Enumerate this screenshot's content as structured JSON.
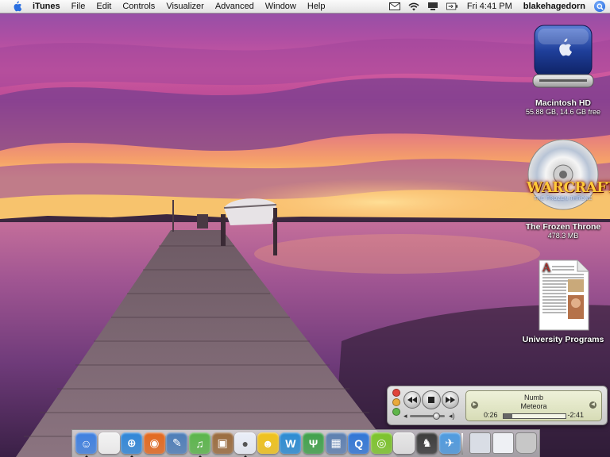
{
  "menubar": {
    "app_name": "iTunes",
    "menus": [
      "File",
      "Edit",
      "Controls",
      "Visualizer",
      "Advanced",
      "Window",
      "Help"
    ],
    "clock": "Fri 4:41 PM",
    "username": "blakehagedorn",
    "extras_icons": [
      "mail-icon",
      "wifi-icon",
      "display-icon",
      "battery-icon"
    ]
  },
  "desktop": {
    "icons": [
      {
        "label": "Macintosh HD",
        "sub": "55.88 GB, 14.6 GB free",
        "icon": "hard-drive-icon"
      },
      {
        "label": "The Frozen Throne",
        "sub": "478.3 MB",
        "icon": "cd-disc-icon",
        "art_text": "WARCRAFT",
        "art_subtext": "THE FROZEN THRONE"
      },
      {
        "label": "University Programs",
        "sub": "",
        "icon": "document-icon"
      }
    ]
  },
  "miniplayer": {
    "song": "Numb",
    "artist": "Meteora",
    "elapsed": "0:26",
    "remaining": "-2:41",
    "progress": 0.14,
    "volume": 0.75
  },
  "dock": {
    "apps": [
      {
        "name": "finder-icon",
        "color": "#3d7fe0",
        "glyph": "☺",
        "running": true
      },
      {
        "name": "blank-app-icon",
        "color": "#f2f2f2",
        "glyph": "",
        "running": false
      },
      {
        "name": "safari-icon",
        "color": "#2f86d8",
        "glyph": "⊕",
        "running": true
      },
      {
        "name": "firefox-icon",
        "color": "#e3681e",
        "glyph": "◉",
        "running": false
      },
      {
        "name": "text-editor-icon",
        "color": "#4d7db8",
        "glyph": "✎",
        "running": false
      },
      {
        "name": "itunes-icon",
        "color": "#5ab54a",
        "glyph": "♫",
        "running": true
      },
      {
        "name": "iphoto-icon",
        "color": "#9a6b3d",
        "glyph": "▣",
        "running": false
      },
      {
        "name": "ichat-icon",
        "color": "#e9eef8",
        "glyph": "●",
        "running": true
      },
      {
        "name": "adium-smiley-icon",
        "color": "#f0c21a",
        "glyph": "☻",
        "running": false
      },
      {
        "name": "word-icon",
        "color": "#2a8bd3",
        "glyph": "W",
        "running": false
      },
      {
        "name": "dreamweaver-icon",
        "color": "#3fa14a",
        "glyph": "Ψ",
        "running": false
      },
      {
        "name": "preview-icon",
        "color": "#5d7fb0",
        "glyph": "▦",
        "running": false
      },
      {
        "name": "quicktime-icon",
        "color": "#2f75d6",
        "glyph": "Q",
        "running": false
      },
      {
        "name": "limewire-icon",
        "color": "#7cc42a",
        "glyph": "◎",
        "running": false
      },
      {
        "name": "apple-icon",
        "color": "#e6e6e6",
        "glyph": "",
        "running": false
      },
      {
        "name": "game-icon",
        "color": "#3b3b3b",
        "glyph": "♞",
        "running": false
      },
      {
        "name": "mail-icon",
        "color": "#4e9be0",
        "glyph": "✈",
        "running": false
      }
    ],
    "right_items": [
      {
        "name": "minimized-window-icon",
        "color": "#d9dde5"
      },
      {
        "name": "minimized-document-icon",
        "color": "#eef0f4"
      },
      {
        "name": "trash-icon",
        "color": "#c7c7c7"
      }
    ]
  }
}
